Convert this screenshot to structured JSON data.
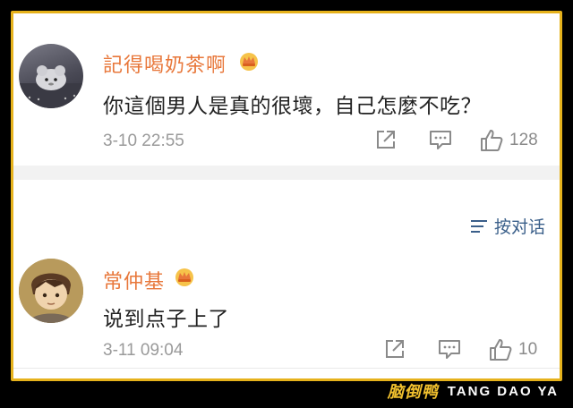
{
  "comments": [
    {
      "username": "記得喝奶茶啊",
      "avatar_icon": "avatar-plush-toy",
      "badge_icon": "vip-crown-badge-icon",
      "text": "你這個男人是真的很壞，自己怎麼不吃？",
      "timestamp": "3-10 22:55",
      "like_count": "128"
    },
    {
      "username": "常仲基",
      "avatar_icon": "avatar-cartoon-boy",
      "badge_icon": "vip-crown-badge-icon",
      "text": "说到点子上了",
      "timestamp": "3-11 09:04",
      "like_count": "10"
    }
  ],
  "sort": {
    "label": "按对话",
    "icon": "sort-lines-icon"
  },
  "brand": {
    "cn": "脑倒鸭",
    "en": "TANG DAO YA"
  },
  "colors": {
    "username": "#e8773a",
    "accent_border": "#e6b21c",
    "sort_link": "#3a5f8a",
    "brand_yellow": "#f2c12e"
  }
}
